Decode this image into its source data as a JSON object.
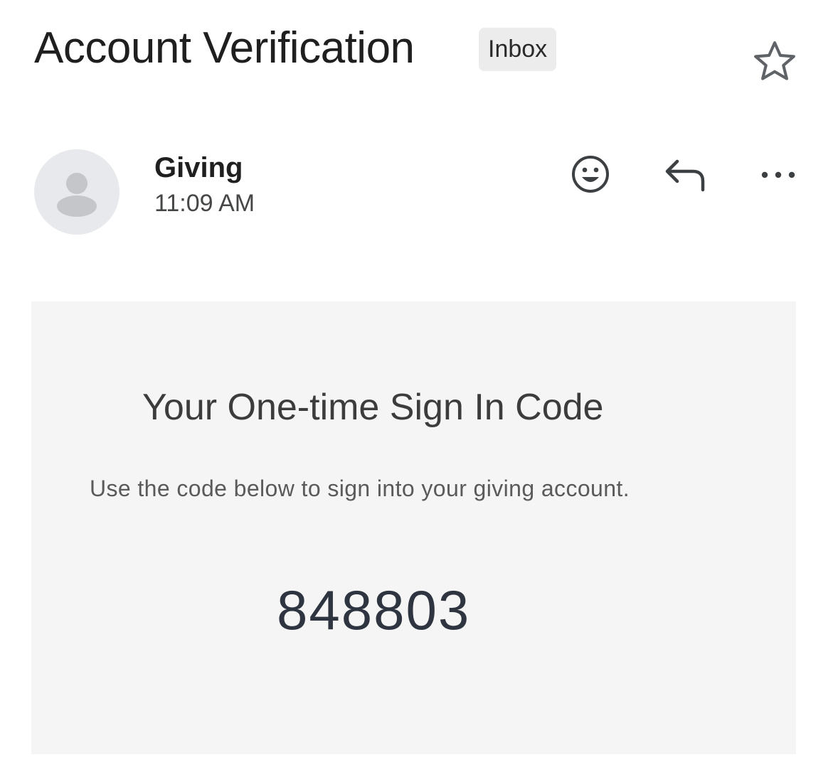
{
  "email": {
    "subject": "Account Verification",
    "label": "Inbox",
    "starred": false
  },
  "sender": {
    "name": "Giving",
    "time": "11:09 AM"
  },
  "icons": {
    "star": "star-outline-icon",
    "avatar": "default-person-icon",
    "emoji": "smiley-face-icon",
    "reply": "reply-arrow-icon",
    "more": "more-horizontal-icon"
  },
  "body": {
    "heading": "Your One-time Sign In Code",
    "instruction": "Use the code below to sign into your giving account.",
    "code": "848803"
  },
  "colors": {
    "body_background": "#f5f5f5",
    "chip_background": "#ececec",
    "code_text": "#2f3540"
  }
}
